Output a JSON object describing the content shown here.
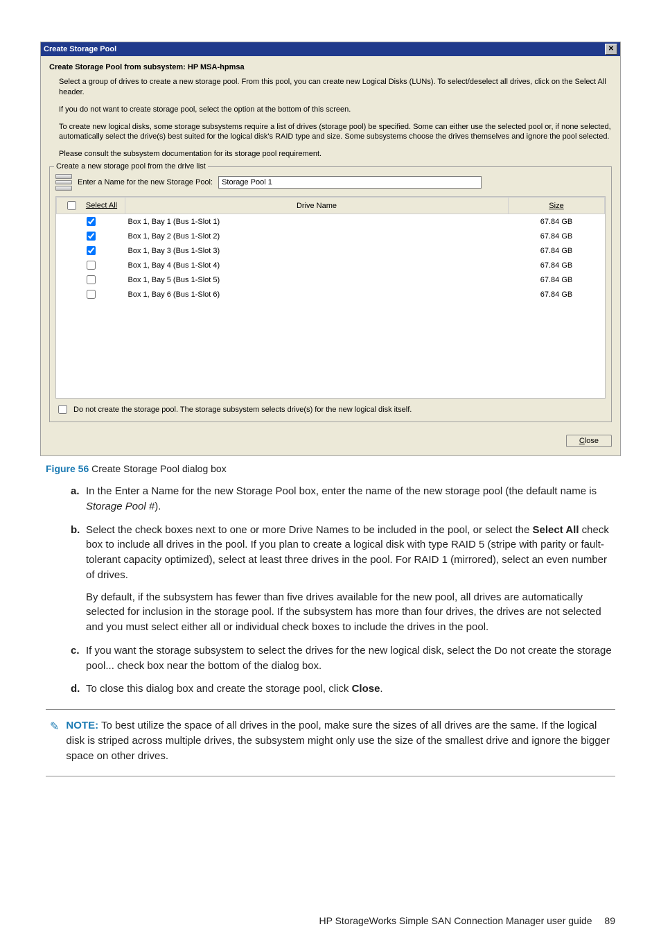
{
  "dialog": {
    "title": "Create Storage Pool",
    "heading": "Create Storage Pool from subsystem: HP MSA-hpmsa",
    "para1": "Select a group of drives to create a new storage pool. From this pool, you can create new Logical Disks (LUNs). To select/deselect all drives, click on the Select All header.",
    "para2": "If you do not want to create storage pool, select the option at the bottom of this screen.",
    "para3": "To create new logical disks, some storage subsystems require a list of drives (storage pool) be specified. Some can either use the selected pool or, if none selected, automatically select the drive(s) best suited for the logical disk's RAID type and size. Some subsystems choose the drives themselves and ignore the pool selected.",
    "para4": "Please consult the subsystem documentation for its storage pool requirement.",
    "legend": "Create a new storage pool from the drive list",
    "name_label": "Enter a Name for the new Storage Pool:",
    "name_value": "Storage Pool 1",
    "col_select": "Select All",
    "col_drive": "Drive Name",
    "col_size": "Size",
    "rows": [
      {
        "checked": true,
        "name": "Box 1, Bay 1 (Bus 1-Slot 1)",
        "size": "67.84 GB"
      },
      {
        "checked": true,
        "name": "Box 1, Bay 2 (Bus 1-Slot 2)",
        "size": "67.84 GB"
      },
      {
        "checked": true,
        "name": "Box 1, Bay 3 (Bus 1-Slot 3)",
        "size": "67.84 GB"
      },
      {
        "checked": false,
        "name": "Box 1, Bay 4 (Bus 1-Slot 4)",
        "size": "67.84 GB"
      },
      {
        "checked": false,
        "name": "Box 1, Bay 5 (Bus 1-Slot 5)",
        "size": "67.84 GB"
      },
      {
        "checked": false,
        "name": "Box 1, Bay 6 (Bus 1-Slot 6)",
        "size": "67.84 GB"
      }
    ],
    "opt_label": "Do not create the storage pool. The storage subsystem selects drive(s) for the new logical disk itself.",
    "close_label": "lose",
    "close_prefix": "C"
  },
  "caption": {
    "label": "Figure 56",
    "text": " Create Storage Pool dialog box"
  },
  "steps": {
    "a_1": "In the Enter a Name for the new Storage Pool box, enter the name of the new storage pool (the default name is ",
    "a_em": "Storage Pool #",
    "a_2": ").",
    "b_1": "Select the check boxes next to one or more Drive Names to be included in the pool, or select the ",
    "b_bold": "Select All",
    "b_2": " check box to include all drives in the pool. If you plan to create a logical disk with type RAID 5 (stripe with parity or fault-tolerant capacity optimized), select at least three drives in the pool. For RAID 1 (mirrored), select an even number of drives.",
    "b_p2": "By default, if the subsystem has fewer than five drives available for the new pool, all drives are automatically selected for inclusion in the storage pool. If the subsystem has more than four drives, the drives are not selected and you must select either all or individual check boxes to include the drives in the pool.",
    "c": "If you want the storage subsystem to select the drives for the new logical disk, select the Do not create the storage pool... check box near the bottom of the dialog box.",
    "d_1": "To close this dialog box and create the storage pool, click ",
    "d_bold": "Close",
    "d_2": "."
  },
  "note": {
    "label": "NOTE:",
    "text": "   To best utilize the space of all drives in the pool, make sure the sizes of all drives are the same. If the logical disk is striped across multiple drives, the subsystem might only use the size of the smallest drive and ignore the bigger space on other drives."
  },
  "footer": {
    "text": "HP StorageWorks Simple SAN Connection Manager user guide",
    "page": "89"
  }
}
